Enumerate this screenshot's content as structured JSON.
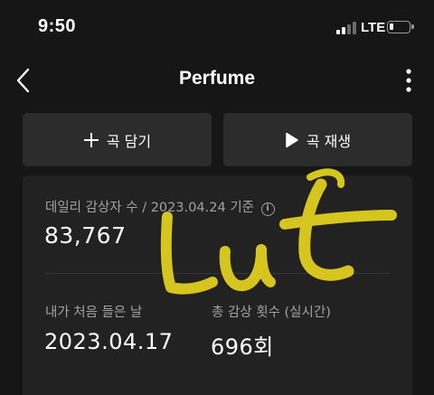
{
  "status_bar": {
    "time": "9:50",
    "network": "LTE",
    "signal_bars_active": 2,
    "signal_bars_total": 4,
    "battery_level_fraction": 0.2
  },
  "header": {
    "title": "Perfume",
    "back_icon": "chevron-left-icon",
    "more_icon": "vertical-ellipsis-icon"
  },
  "actions": {
    "add": {
      "icon": "plus-icon",
      "label": "곡 담기"
    },
    "play": {
      "icon": "play-icon",
      "label": "곡 재생"
    }
  },
  "stats": {
    "daily_label": "데일리 감상자 수 / 2023.04.24 기준",
    "daily_value": "83,767",
    "first_listen_label": "내가 처음 들은 날",
    "first_listen_value": "2023.04.17",
    "total_plays_label": "총 감상 횟수 (실시간)",
    "total_plays_value": "696회"
  },
  "colors": {
    "background": "#161616",
    "button_bg": "#2c2c2c",
    "card_bg": "#222222",
    "muted_text": "#a2a2a2",
    "scribble": "#e6d21f"
  }
}
